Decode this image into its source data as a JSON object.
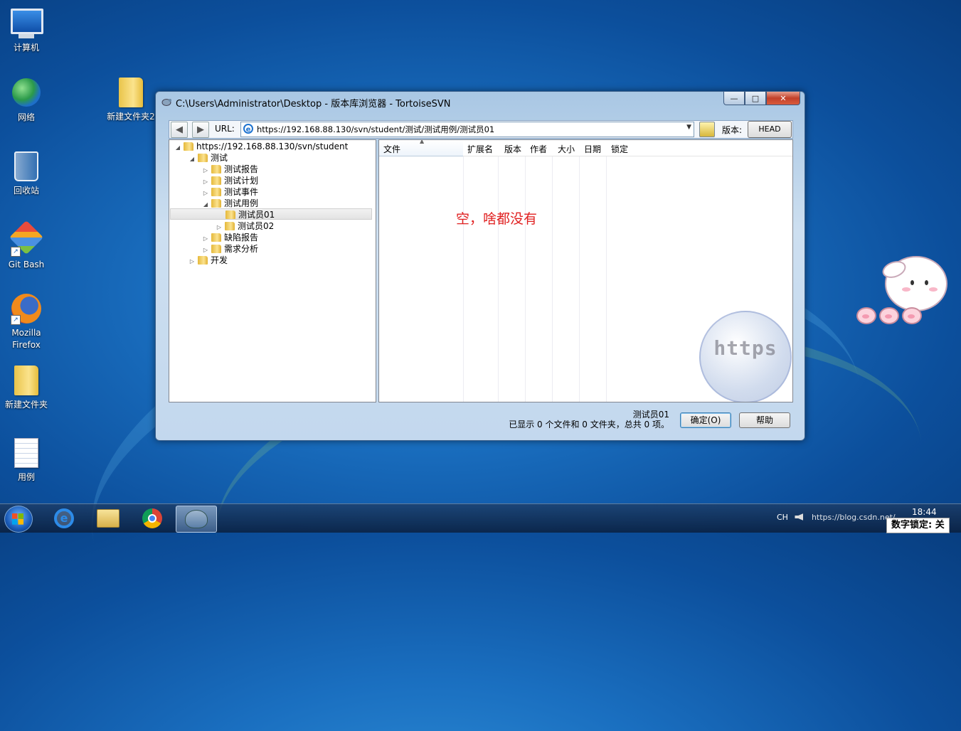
{
  "desktop": {
    "icons": [
      {
        "label": "计算机"
      },
      {
        "label": "网络"
      },
      {
        "label": "回收站"
      },
      {
        "label": "Git Bash"
      },
      {
        "label": "Mozilla Firefox"
      },
      {
        "label": "新建文件夹"
      },
      {
        "label": "用例"
      },
      {
        "label": "新建文件夹2"
      }
    ]
  },
  "window": {
    "title": "C:\\Users\\Administrator\\Desktop - 版本库浏览器 - TortoiseSVN",
    "controls": {
      "minimize": "—",
      "maximize": "□",
      "close": "✕"
    }
  },
  "toolbar": {
    "url_label": "URL:",
    "url_value": "https://192.168.88.130/svn/student/测试/测试用例/测试员01",
    "revision_label": "版本:",
    "revision_button": "HEAD"
  },
  "tree": {
    "nodes": [
      {
        "label": "https://192.168.88.130/svn/student",
        "level": 0,
        "expanded": true
      },
      {
        "label": "测试",
        "level": 1,
        "expanded": true
      },
      {
        "label": "测试报告",
        "level": 2,
        "expanded": false
      },
      {
        "label": "测试计划",
        "level": 2,
        "expanded": false
      },
      {
        "label": "测试事件",
        "level": 2,
        "expanded": false
      },
      {
        "label": "测试用例",
        "level": 2,
        "expanded": true
      },
      {
        "label": "测试员01",
        "level": 3,
        "selected": true
      },
      {
        "label": "测试员02",
        "level": 3,
        "expanded": false
      },
      {
        "label": "缺陷报告",
        "level": 2,
        "expanded": false
      },
      {
        "label": "需求分析",
        "level": 2,
        "expanded": false
      },
      {
        "label": "开发",
        "level": 1,
        "expanded": false
      }
    ]
  },
  "file_list": {
    "columns": [
      "文件",
      "扩展名",
      "版本",
      "作者",
      "大小",
      "日期",
      "锁定"
    ],
    "rows": [],
    "annotation": "空，啥都没有",
    "watermark": "https"
  },
  "status": {
    "selected": "测试员01",
    "summary": "已显示 0 个文件和 0 文件夹，总共 0 项。"
  },
  "buttons": {
    "ok": "确定(O)",
    "help": "帮助"
  },
  "taskbar": {
    "tray_text": "CH",
    "tray_url": "https://blog.csdn.net/",
    "clock": "18:44",
    "numlock": "数字锁定: 关"
  }
}
